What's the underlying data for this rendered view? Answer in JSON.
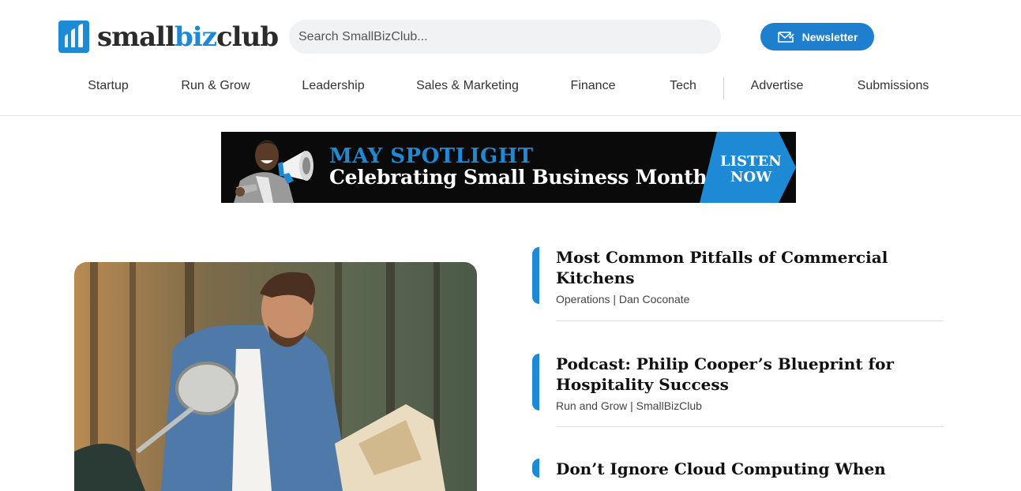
{
  "brand": {
    "name_start": "small",
    "name_mid": "biz",
    "name_end": "club",
    "accent": "#1e8ad6"
  },
  "search": {
    "placeholder": "Search SmallBizClub..."
  },
  "newsletter": {
    "label": "Newsletter",
    "icon": "envelope-icon"
  },
  "nav": {
    "items": [
      "Startup",
      "Run & Grow",
      "Leadership",
      "Sales & Marketing",
      "Finance",
      "Tech",
      "Advertise",
      "Submissions"
    ]
  },
  "banner": {
    "headline": "MAY SPOTLIGHT",
    "subheadline": "Celebrating Small Business Month",
    "cta_line1": "LISTEN",
    "cta_line2": "NOW"
  },
  "articles": [
    {
      "title": "Most Common Pitfalls of Commercial Kitchens",
      "meta": "Operations | Dan Coconate"
    },
    {
      "title": "Podcast: Philip Cooper’s Blueprint for Hospitality Success",
      "meta": "Run and Grow | SmallBizClub"
    },
    {
      "title": "Don’t Ignore Cloud Computing When"
    }
  ]
}
